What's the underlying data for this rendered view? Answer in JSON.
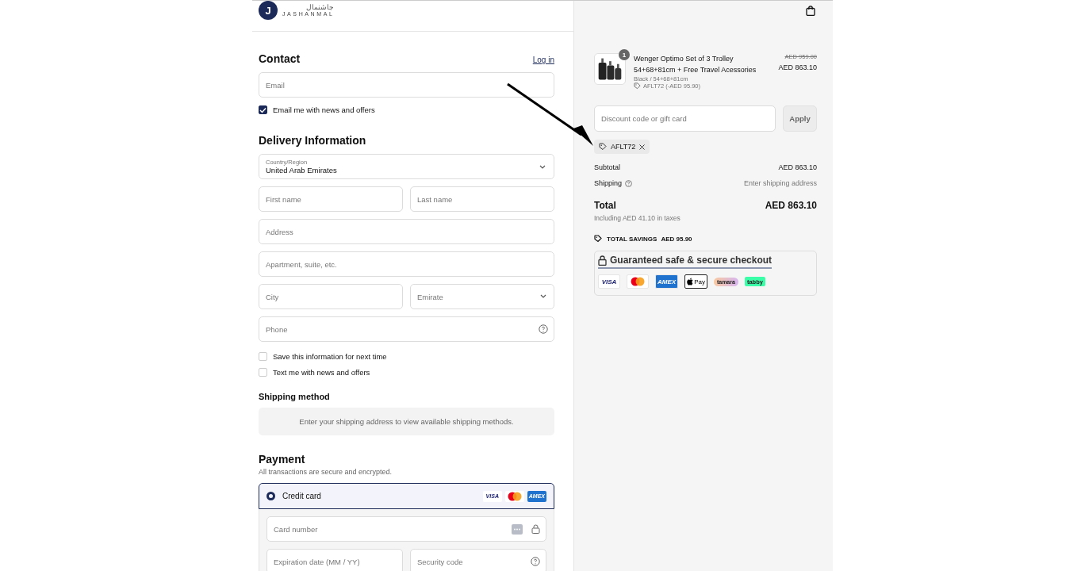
{
  "header": {
    "logo_letter": "J",
    "logo_arabic": "جاشنمال",
    "logo_latin": "JASHANMAL"
  },
  "contact": {
    "title": "Contact",
    "login_link": "Log in",
    "email": {
      "placeholder": "Email"
    },
    "newsletter": {
      "label": "Email me with news and offers",
      "checked": true
    }
  },
  "delivery": {
    "title": "Delivery Information",
    "rows": [
      {
        "fields": [
          {
            "kind": "select",
            "label": "Country/Region",
            "value": "United Arab Emirates"
          }
        ]
      },
      {
        "fields": [
          {
            "kind": "text",
            "placeholder": "First name"
          },
          {
            "kind": "text",
            "placeholder": "Last name"
          }
        ]
      },
      {
        "fields": [
          {
            "kind": "text",
            "placeholder": "Address"
          }
        ]
      },
      {
        "fields": [
          {
            "kind": "text",
            "placeholder": "Apartment, suite, etc."
          }
        ]
      },
      {
        "fields": [
          {
            "kind": "text",
            "placeholder": "City"
          },
          {
            "kind": "select",
            "placeholder": "Emirate"
          }
        ]
      },
      {
        "fields": [
          {
            "kind": "help",
            "placeholder": "Phone"
          }
        ]
      }
    ],
    "options": [
      {
        "label": "Save this information for next time",
        "checked": false
      },
      {
        "label": "Text me with news and offers",
        "checked": false
      }
    ]
  },
  "shipping_method": {
    "title": "Shipping method",
    "message": "Enter your shipping address to view available shipping methods."
  },
  "payment": {
    "title": "Payment",
    "subtitle": "All transactions are secure and encrypted.",
    "methods": [
      {
        "label": "Credit card",
        "selected": true,
        "cards": [
          {
            "kind": "visa",
            "text": "VISA"
          },
          {
            "kind": "mastercard"
          },
          {
            "kind": "amex",
            "text": "AMEX"
          }
        ]
      }
    ],
    "card_rows": [
      {
        "fields": [
          {
            "kind": "lock",
            "placeholder": "Card number"
          }
        ]
      },
      {
        "fields": [
          {
            "kind": "text",
            "placeholder": "Expiration date (MM / YY)"
          },
          {
            "kind": "help",
            "placeholder": "Security code"
          }
        ]
      }
    ]
  },
  "summary": {
    "item": {
      "quantity": "1",
      "name": "Wenger Optimo Set of 3 Trolley 54+68+81cm + Free Travel Acessories",
      "original_price": "AED 959.00",
      "price": "AED 863.10",
      "variant": "Black / 54+68+81cm",
      "discount": "AFLT72 (-AED 95.90)"
    },
    "discount_field": {
      "placeholder": "Discount code or gift card"
    },
    "apply_button": "Apply",
    "applied_code": "AFLT72",
    "subtotal": {
      "label": "Subtotal",
      "value": "AED 863.10"
    },
    "shipping": {
      "label": "Shipping",
      "value": "Enter shipping address"
    },
    "total": {
      "label": "Total",
      "value": "AED 863.10"
    },
    "taxes": "Including AED 41.10 in taxes",
    "savings": {
      "label": "TOTAL SAVINGS",
      "value": "AED 95.90"
    },
    "secure": {
      "title": "Guaranteed safe & secure checkout",
      "badges": [
        {
          "kind": "visa",
          "text": "VISA"
        },
        {
          "kind": "mastercard"
        },
        {
          "kind": "amex",
          "text": "AMEX"
        },
        {
          "kind": "applepay",
          "text": "Pay"
        },
        {
          "kind": "tamara",
          "text": "tamara"
        },
        {
          "kind": "tabby",
          "text": "tabby"
        }
      ]
    }
  }
}
